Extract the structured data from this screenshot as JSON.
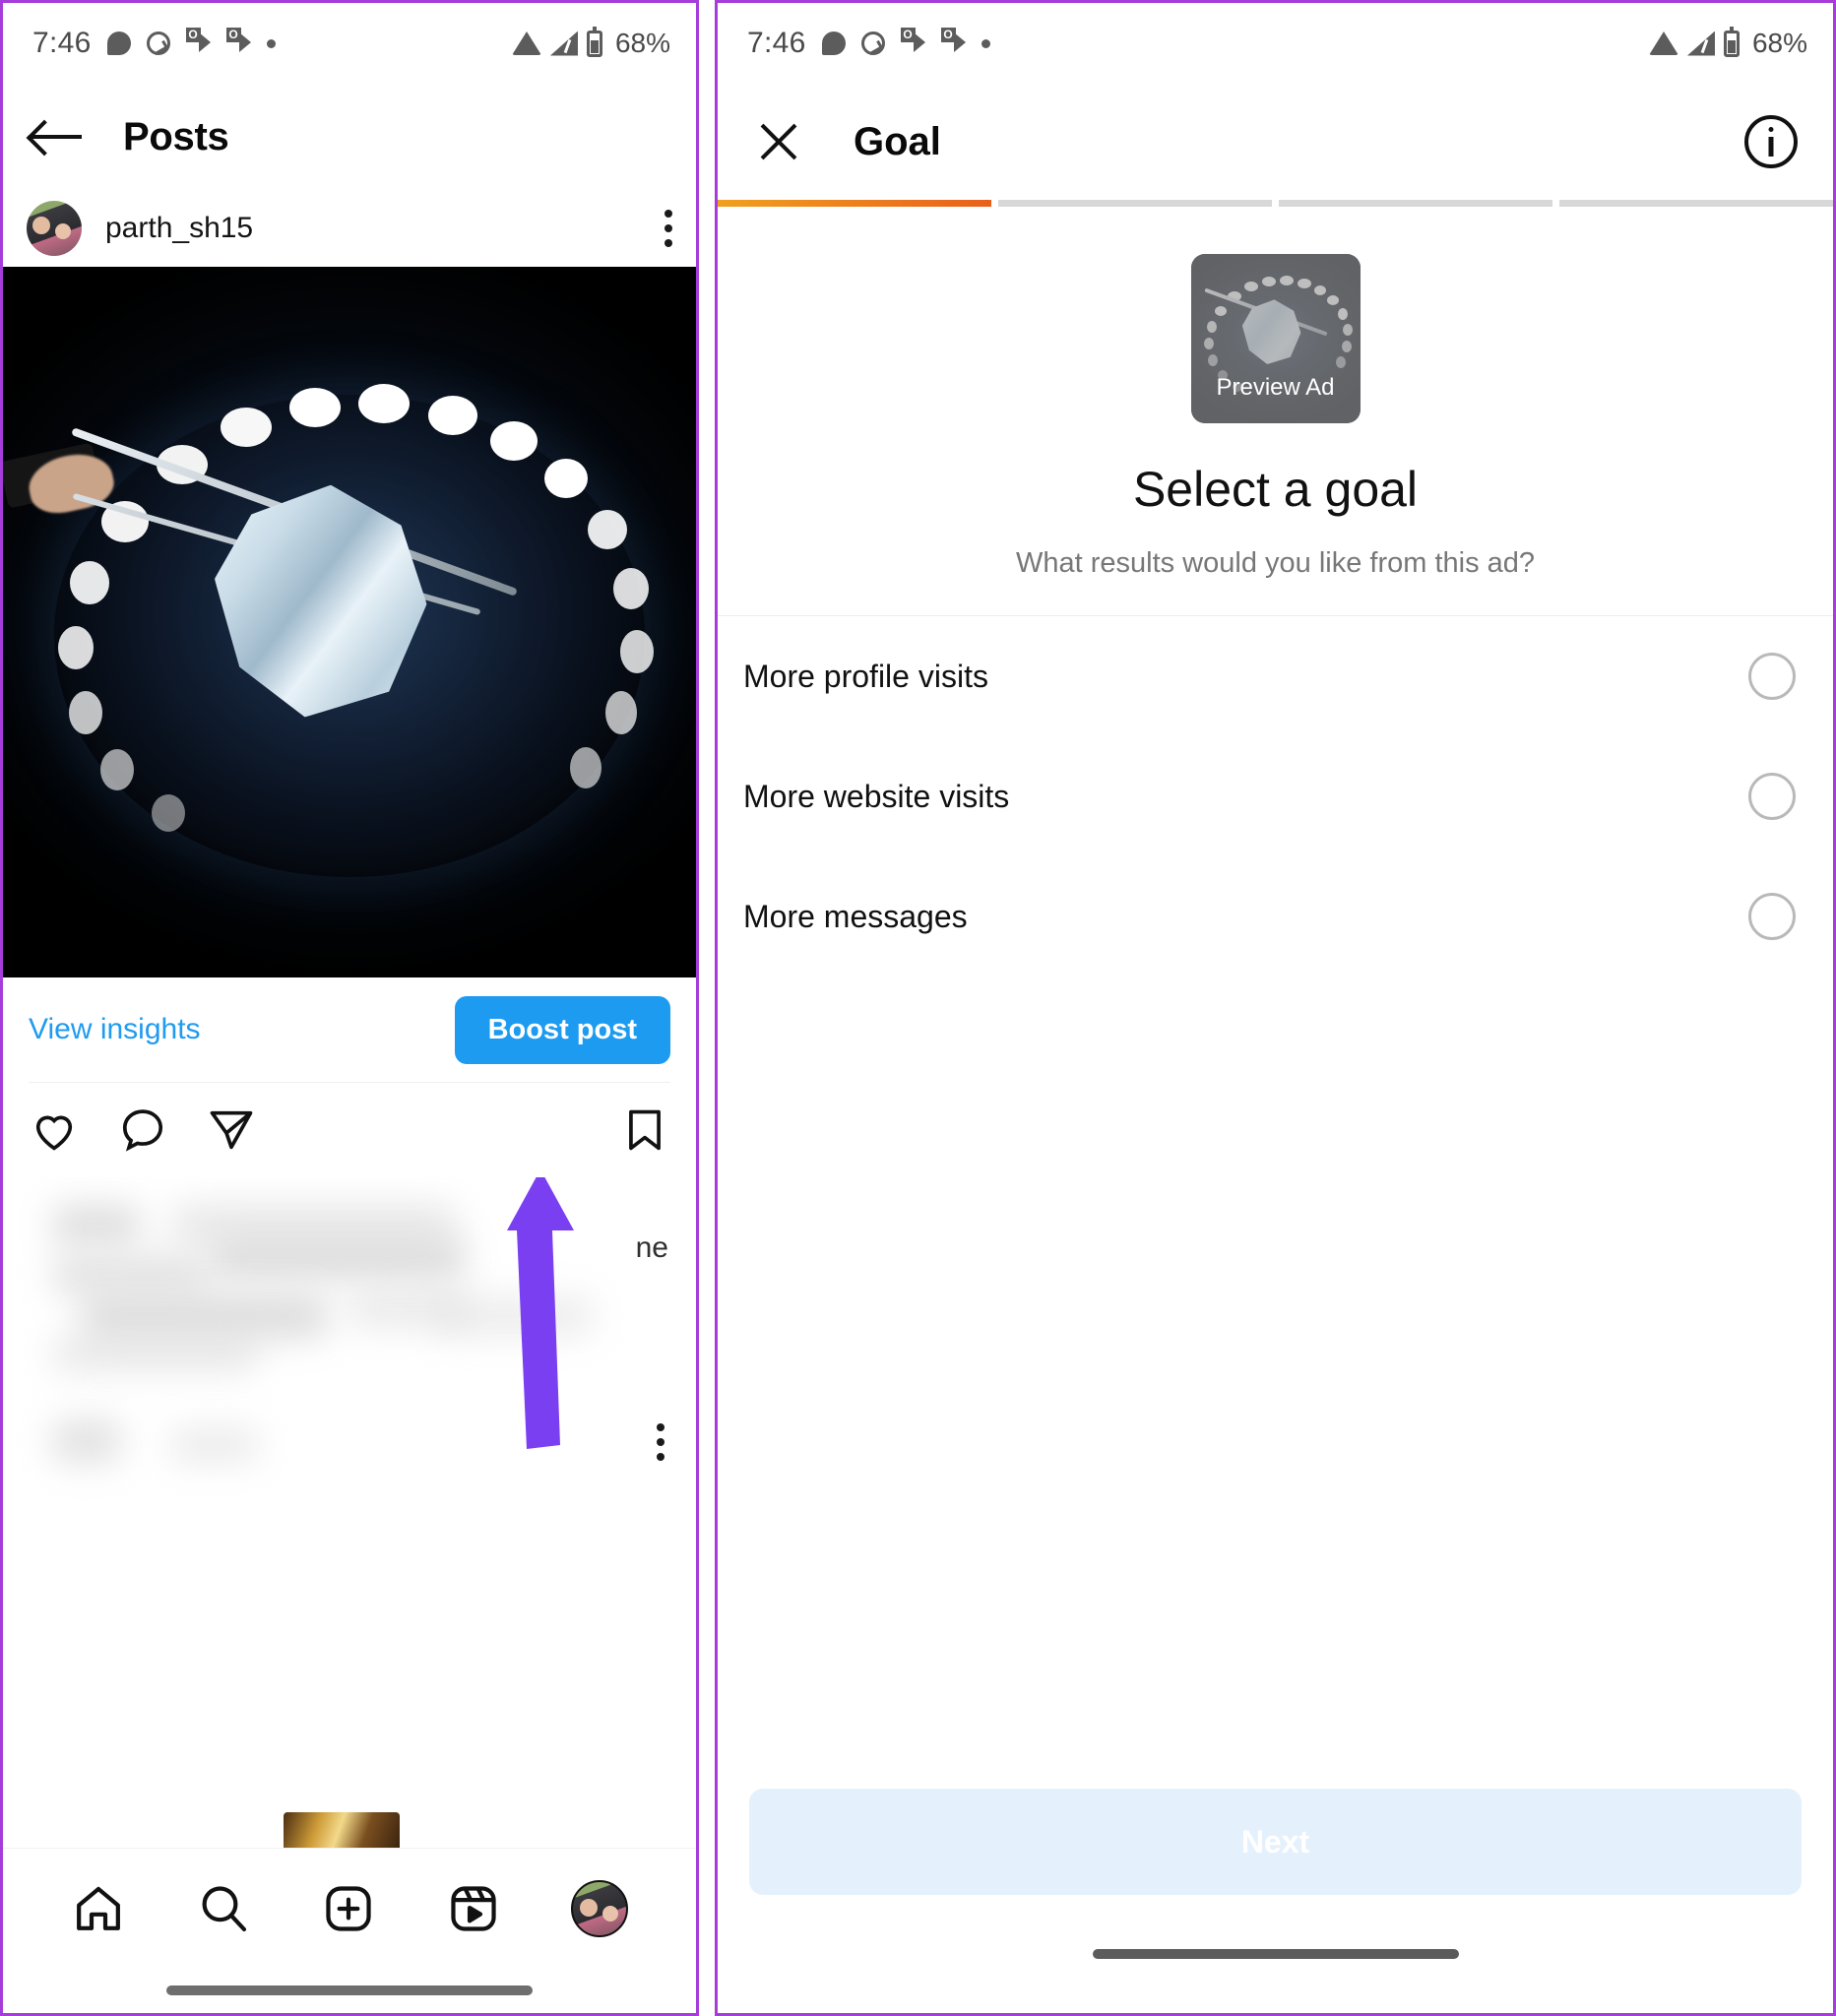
{
  "accent": {
    "instagram_blue": "#1d9bf0",
    "link_blue": "#1f9bf0",
    "progress_orange_start": "#f0a020",
    "progress_orange_end": "#e8601c",
    "arrow_purple": "#7b3ff2",
    "next_disabled_bg": "#e4f1fd"
  },
  "status_bar": {
    "time": "7:46",
    "battery_percent": "68%",
    "left_icons": [
      "chat-bubble-icon",
      "clock-check-icon",
      "outlook-icon",
      "outlook-icon",
      "dot-icon"
    ],
    "right_icons": [
      "wifi-icon",
      "cellular-signal-icon",
      "battery-icon"
    ]
  },
  "left_screen": {
    "header": {
      "back_label": "back-arrow",
      "title": "Posts"
    },
    "post": {
      "username": "parth_sh15",
      "menu_icon": "kebab-menu-icon",
      "image_alt": "rough diamond held by tweezers under ring light"
    },
    "boost_row": {
      "view_insights_label": "View insights",
      "boost_label": "Boost post"
    },
    "actions": [
      "heart-icon",
      "comment-icon",
      "share-icon",
      "bookmark-icon"
    ],
    "caption": {
      "blurred": true,
      "visible_fragment": "ne"
    },
    "annotation": {
      "type": "arrow-up",
      "points_to": "Boost post"
    },
    "bottom_nav": [
      {
        "name": "home-icon",
        "label": "Home"
      },
      {
        "name": "search-icon",
        "label": "Search"
      },
      {
        "name": "add-post-icon",
        "label": "Create"
      },
      {
        "name": "reels-icon",
        "label": "Reels"
      },
      {
        "name": "profile-avatar",
        "label": "Profile"
      }
    ]
  },
  "right_screen": {
    "header": {
      "close_icon": "close-icon",
      "title": "Goal",
      "info_icon": "info-icon"
    },
    "progress": {
      "total_steps": 4,
      "current_step": 1
    },
    "preview": {
      "label": "Preview Ad"
    },
    "heading": "Select a goal",
    "subheading": "What results would you like from this ad?",
    "options": [
      {
        "label": "More profile visits",
        "selected": false
      },
      {
        "label": "More website visits",
        "selected": false
      },
      {
        "label": "More messages",
        "selected": false
      }
    ],
    "footer": {
      "next_label": "Next",
      "next_enabled": false
    }
  }
}
